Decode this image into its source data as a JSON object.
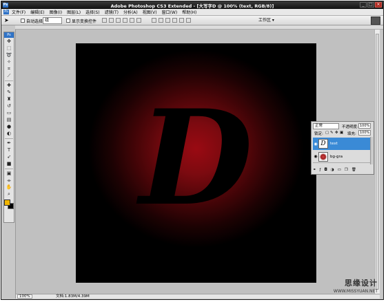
{
  "app": {
    "badge": "Ps",
    "title": "Adobe Photoshop CS3 Extended - [大写字D @ 100% (text, RGB/8)]"
  },
  "window_controls": {
    "minimize": "_",
    "maximize": "□",
    "close": "×"
  },
  "menu": {
    "items": [
      "文件(F)",
      "编辑(E)",
      "图像(I)",
      "图层(L)",
      "选择(S)",
      "滤镜(T)",
      "分析(A)",
      "视图(V)",
      "窗口(W)",
      "帮助(H)"
    ]
  },
  "options_bar": {
    "auto_select_label": "自动选择:",
    "auto_select_value": "组",
    "show_transform_label": "显示变换控件",
    "workspace_label": "工作区 ▾"
  },
  "toolbox": {
    "header": "Ps",
    "tools": [
      "move-icon",
      "marquee-icon",
      "lasso-icon",
      "magic-wand-icon",
      "crop-icon",
      "slice-icon",
      "healing-icon",
      "brush-icon",
      "clone-stamp-icon",
      "history-brush-icon",
      "eraser-icon",
      "gradient-icon",
      "blur-icon",
      "dodge-icon",
      "pen-icon",
      "type-icon",
      "path-select-icon",
      "shape-icon",
      "notes-icon",
      "eyedropper-icon",
      "hand-icon",
      "zoom-icon"
    ],
    "fg_color": "#f2b600",
    "bg_color": "#000000"
  },
  "canvas": {
    "letter": "D",
    "glow_color": "#9a0a12",
    "base_color": "#000000"
  },
  "status_bar": {
    "zoom": "100%",
    "doc_size": "文档:1.83M/4.39M"
  },
  "layers_panel": {
    "blend_mode": "正常",
    "opacity_label": "不透明度:",
    "opacity_value": "100%",
    "lock_label": "锁定:",
    "fill_label": "填充:",
    "fill_value": "100%",
    "layers": [
      {
        "name": "text",
        "selected": true,
        "thumb": "D"
      },
      {
        "name": "bg-gra",
        "selected": false
      }
    ],
    "footer_icons": [
      "link-icon",
      "fx-icon",
      "mask-icon",
      "adjustment-icon",
      "folder-icon",
      "new-layer-icon",
      "trash-icon"
    ]
  },
  "watermark": {
    "line1": "思缘设计",
    "line2": "WWW.MISSYUAN.NET"
  },
  "colors": {
    "title_bar": "#101010",
    "selection": "#3a8ad6",
    "workspace_bg": "#c0c0c0"
  }
}
